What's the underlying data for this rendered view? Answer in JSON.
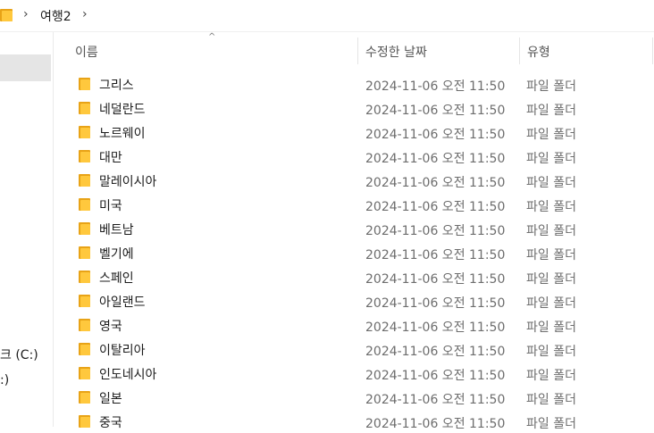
{
  "address": {
    "breadcrumb": [
      "여행2"
    ]
  },
  "nav": {
    "drive_c_label": "크 (C:)",
    "drive_d_label": ":)"
  },
  "columns": {
    "name": "이름",
    "date": "수정한 날짜",
    "type": "유형",
    "sort_indicator": "^"
  },
  "icons": {
    "folder": "folder-icon",
    "chevron": "chevron-right-icon"
  },
  "colors": {
    "folder_yellow": "#ffc83d",
    "folder_dark": "#e8a317",
    "selection": "#e5e5e5"
  },
  "files": [
    {
      "name": "그리스",
      "date": "2024-11-06 오전 11:50",
      "type": "파일 폴더"
    },
    {
      "name": "네덜란드",
      "date": "2024-11-06 오전 11:50",
      "type": "파일 폴더"
    },
    {
      "name": "노르웨이",
      "date": "2024-11-06 오전 11:50",
      "type": "파일 폴더"
    },
    {
      "name": "대만",
      "date": "2024-11-06 오전 11:50",
      "type": "파일 폴더"
    },
    {
      "name": "말레이시아",
      "date": "2024-11-06 오전 11:50",
      "type": "파일 폴더"
    },
    {
      "name": "미국",
      "date": "2024-11-06 오전 11:50",
      "type": "파일 폴더"
    },
    {
      "name": "베트남",
      "date": "2024-11-06 오전 11:50",
      "type": "파일 폴더"
    },
    {
      "name": "벨기에",
      "date": "2024-11-06 오전 11:50",
      "type": "파일 폴더"
    },
    {
      "name": "스페인",
      "date": "2024-11-06 오전 11:50",
      "type": "파일 폴더"
    },
    {
      "name": "아일랜드",
      "date": "2024-11-06 오전 11:50",
      "type": "파일 폴더"
    },
    {
      "name": "영국",
      "date": "2024-11-06 오전 11:50",
      "type": "파일 폴더"
    },
    {
      "name": "이탈리아",
      "date": "2024-11-06 오전 11:50",
      "type": "파일 폴더"
    },
    {
      "name": "인도네시아",
      "date": "2024-11-06 오전 11:50",
      "type": "파일 폴더"
    },
    {
      "name": "일본",
      "date": "2024-11-06 오전 11:50",
      "type": "파일 폴더"
    },
    {
      "name": "중국",
      "date": "2024-11-06 오전 11:50",
      "type": "파일 폴더"
    }
  ]
}
